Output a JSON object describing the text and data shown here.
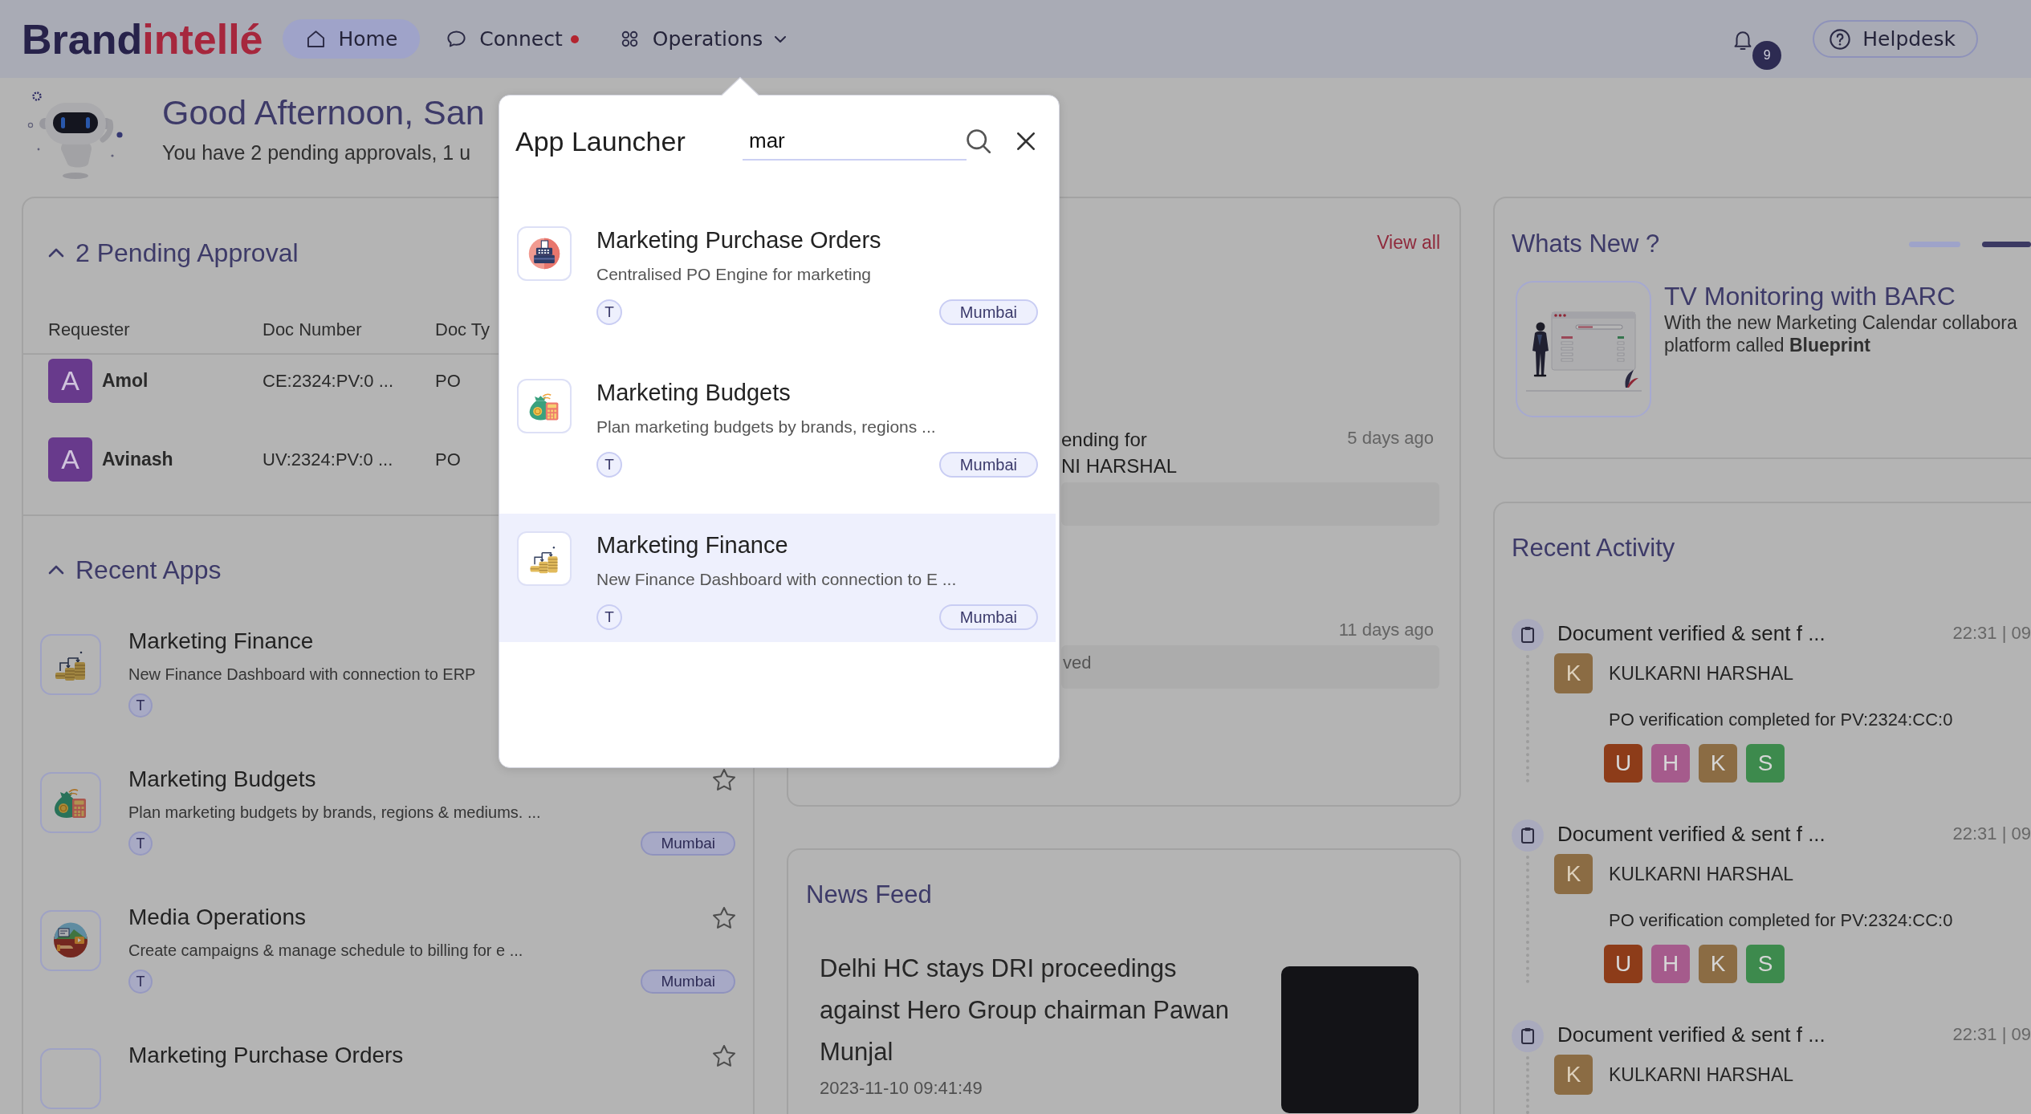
{
  "navbar": {
    "logo": [
      "Brand",
      "intellé"
    ],
    "items": [
      {
        "label": "Home",
        "kind": "home",
        "selected": true
      },
      {
        "label": "Connect",
        "kind": "chat",
        "selected": false,
        "unread": true
      },
      {
        "label": "Operations",
        "kind": "apps",
        "selected": false,
        "menu": true
      }
    ],
    "notifications": {
      "count": "9"
    },
    "help_button": {
      "label": "Helpdesk"
    }
  },
  "greeting": {
    "title": "Good Afternoon, San",
    "subtitle": "You have 2 pending approvals, 1 u"
  },
  "pending_approval": {
    "title": "2 Pending Approval",
    "expanded": true,
    "columns": [
      "Requester",
      "Doc Number",
      "Doc Ty"
    ],
    "rows": [
      {
        "initial": "A",
        "requester": "Amol",
        "doc_number": "CE:2324:PV:0 ...",
        "doc_type": "PO"
      },
      {
        "initial": "A",
        "requester": "Avinash",
        "doc_number": "UV:2324:PV:0 ...",
        "doc_type": "PO"
      }
    ]
  },
  "recent_apps": {
    "title": "Recent Apps",
    "expanded": true,
    "items": [
      {
        "kind": "finance",
        "title": "Marketing Finance",
        "description": "New Finance Dashboard with connection to ERP",
        "initial": "T"
      },
      {
        "kind": "budget",
        "title": "Marketing Budgets",
        "description": "Plan marketing budgets by brands, regions & mediums. ...",
        "initial": "T",
        "tag": "Mumbai",
        "starred": false
      },
      {
        "kind": "media",
        "title": "Media Operations",
        "description": "Create campaigns & manage schedule to billing for e ...",
        "initial": "T",
        "tag": "Mumbai",
        "starred": false
      },
      {
        "title": "Marketing Purchase Orders",
        "starred": false
      }
    ]
  },
  "middle_panel": {
    "link": "View all",
    "items": [
      {
        "lines": [
          "ending for",
          "NI HARSHAL"
        ],
        "time": "5 days ago"
      },
      {
        "time": "11 days ago",
        "note": "ved"
      }
    ]
  },
  "news_feed": {
    "title": "News Feed",
    "items": [
      {
        "headline": "Delhi HC stays DRI proceedings against Hero Group chairman Pawan Munjal",
        "date": "2023-11-10 09:41:49"
      }
    ]
  },
  "whats_new": {
    "title": "Whats New ?",
    "pages": [
      {
        "selected": false
      },
      {
        "selected": true
      }
    ],
    "headline": "TV Monitoring with BARC",
    "lines": [
      "With the new Marketing Calendar collabora",
      "platform called **Blueprint**"
    ]
  },
  "recent_activity": {
    "title": "Recent Activity",
    "items": [
      {
        "title": "Document verified & sent f ...",
        "time": "22:31 | 09",
        "user_initial": "K",
        "user": "KULKARNI HARSHAL",
        "message": "PO verification completed for PV:2324:CC:0",
        "participants": [
          {
            "initial": "U",
            "color": "#8d3c19"
          },
          {
            "initial": "H",
            "color": "#a55b8c"
          },
          {
            "initial": "K",
            "color": "#8b6c44"
          },
          {
            "initial": "S",
            "color": "#3d8a4d"
          }
        ]
      },
      {
        "title": "Document verified & sent f ...",
        "time": "22:31 | 09",
        "user_initial": "K",
        "user": "KULKARNI HARSHAL",
        "message": "PO verification completed for PV:2324:CC:0",
        "participants": [
          {
            "initial": "U",
            "color": "#8d3c19"
          },
          {
            "initial": "H",
            "color": "#a55b8c"
          },
          {
            "initial": "K",
            "color": "#8b6c44"
          },
          {
            "initial": "S",
            "color": "#3d8a4d"
          }
        ]
      },
      {
        "title": "Document verified & sent f ...",
        "time": "22:31 | 09",
        "user_initial": "K",
        "user": "KULKARNI HARSHAL"
      }
    ]
  },
  "app_launcher": {
    "title": "App Launcher",
    "search": {
      "value": "mar"
    },
    "results": [
      {
        "kind": "register",
        "title": "Marketing Purchase Orders",
        "description": "Centralised PO Engine for marketing",
        "initial": "T",
        "tag": "Mumbai",
        "selected": false
      },
      {
        "kind": "budget",
        "title": "Marketing Budgets",
        "description": "Plan marketing budgets by brands, regions ...",
        "initial": "T",
        "tag": "Mumbai",
        "selected": false
      },
      {
        "kind": "finance",
        "title": "Marketing Finance",
        "description": "New Finance Dashboard with connection to E ...",
        "initial": "T",
        "tag": "Mumbai",
        "selected": true
      }
    ]
  }
}
